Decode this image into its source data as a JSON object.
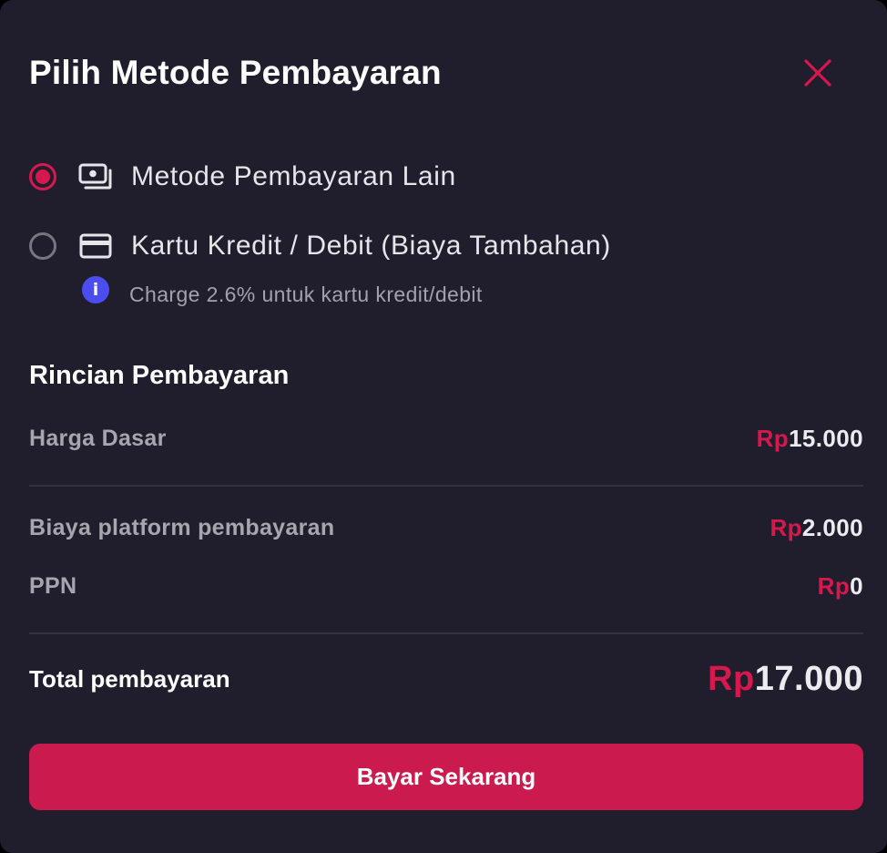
{
  "modal": {
    "title": "Pilih Metode Pembayaran"
  },
  "colors": {
    "background": "#201e2c",
    "accent": "#d6184f",
    "button": "#cb1a4d",
    "info": "#4b4df0",
    "divider": "#34323f"
  },
  "payment_options": [
    {
      "label": "Metode Pembayaran Lain",
      "icon": "cash-icon",
      "selected": true
    },
    {
      "label": "Kartu Kredit / Debit (Biaya Tambahan)",
      "icon": "credit-card-icon",
      "selected": false
    }
  ],
  "card_note": {
    "icon": "info-icon",
    "glyph": "i",
    "text": "Charge 2.6% untuk kartu kredit/debit"
  },
  "details": {
    "title": "Rincian Pembayaran",
    "currency": "Rp",
    "base_price": {
      "label": "Harga Dasar",
      "amount": "15.000"
    },
    "platform_fee": {
      "label": "Biaya platform pembayaran",
      "amount": "2.000"
    },
    "tax": {
      "label": "PPN",
      "amount": "0"
    },
    "total": {
      "label": "Total pembayaran",
      "amount": "17.000"
    }
  },
  "pay_button": {
    "label": "Bayar Sekarang"
  }
}
